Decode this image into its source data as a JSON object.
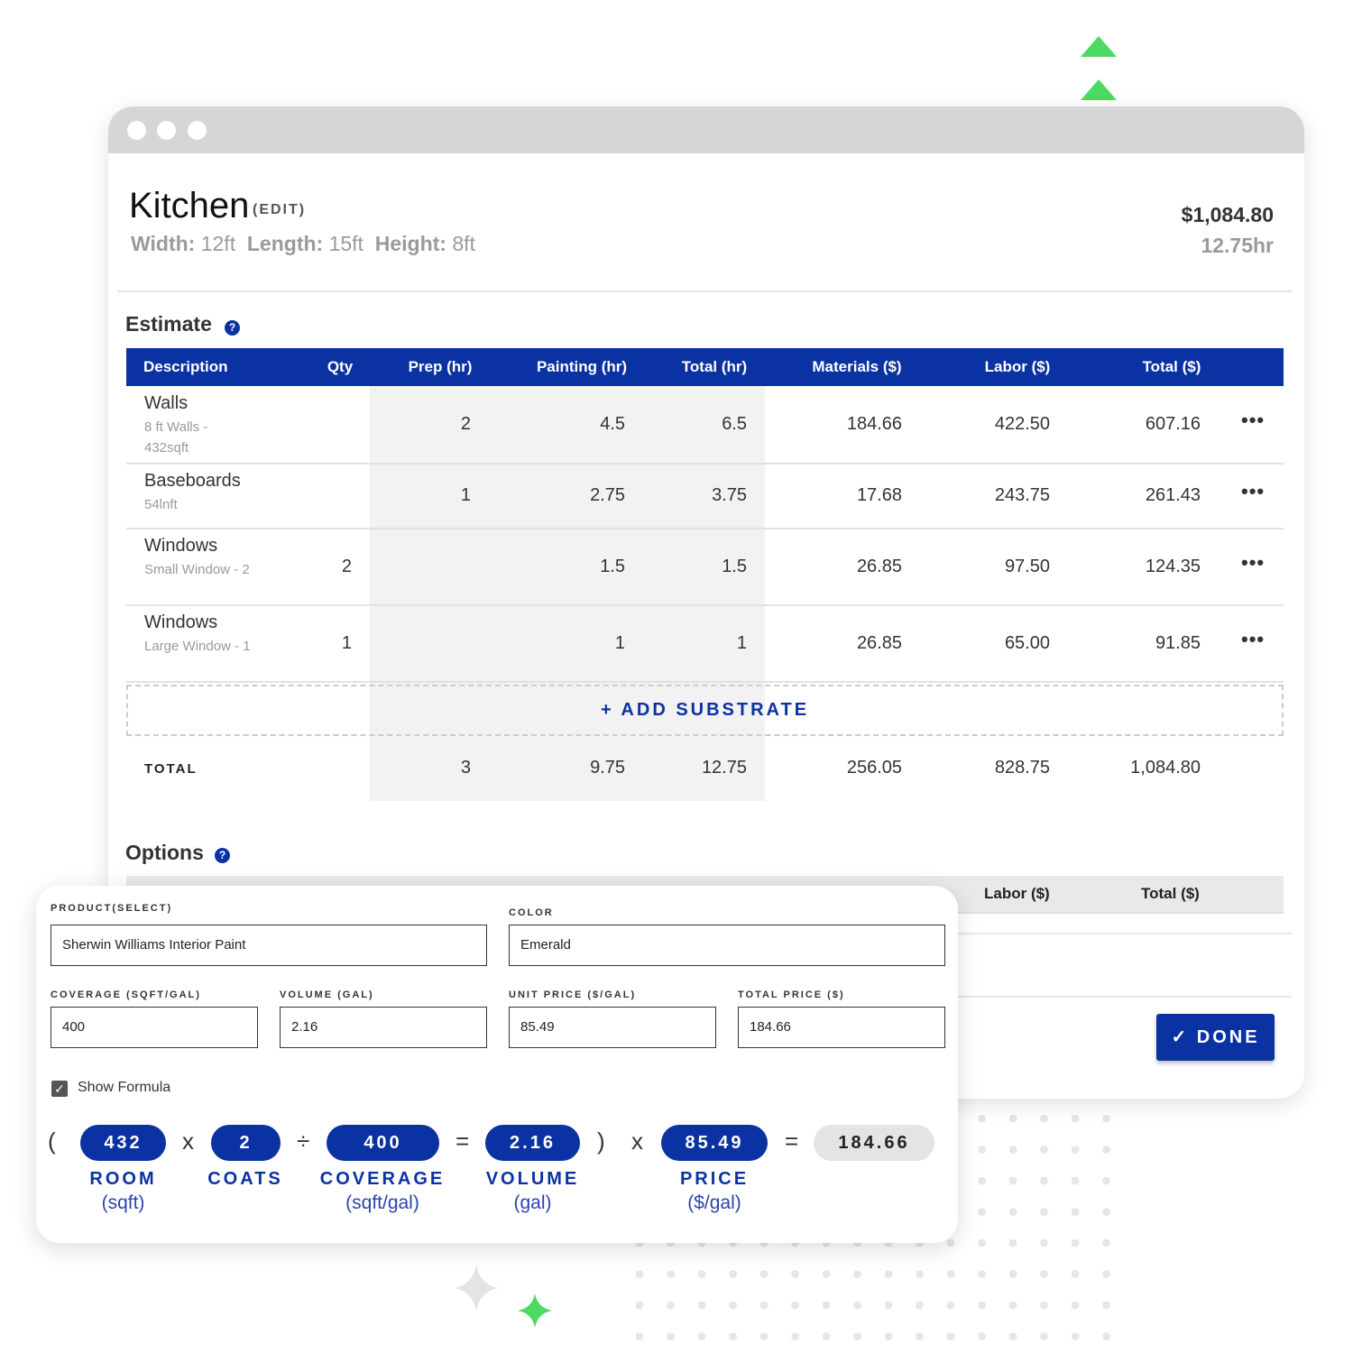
{
  "room": {
    "name": "Kitchen",
    "edit_label": "(EDIT)",
    "dimensions": [
      {
        "label": "Width:",
        "value": "12ft"
      },
      {
        "label": "Length:",
        "value": "15ft"
      },
      {
        "label": "Height:",
        "value": "8ft"
      }
    ],
    "total_price": "$1,084.80",
    "total_hours": "12.75hr"
  },
  "estimate": {
    "title": "Estimate",
    "columns": [
      "Description",
      "Qty",
      "Prep (hr)",
      "Painting (hr)",
      "Total (hr)",
      "Materials ($)",
      "Labor ($)",
      "Total ($)"
    ],
    "rows": [
      {
        "name": "Walls",
        "sub": "8 ft Walls - 432sqft",
        "qty": "",
        "prep": "2",
        "painting": "4.5",
        "total_hr": "6.5",
        "materials": "184.66",
        "labor": "422.50",
        "total": "607.16"
      },
      {
        "name": "Baseboards",
        "sub": "54lnft",
        "qty": "",
        "prep": "1",
        "painting": "2.75",
        "total_hr": "3.75",
        "materials": "17.68",
        "labor": "243.75",
        "total": "261.43"
      },
      {
        "name": "Windows",
        "sub": "Small Window - 2",
        "qty": "2",
        "prep": "",
        "painting": "1.5",
        "total_hr": "1.5",
        "materials": "26.85",
        "labor": "97.50",
        "total": "124.35"
      },
      {
        "name": "Windows",
        "sub": "Large Window - 1",
        "qty": "1",
        "prep": "",
        "painting": "1",
        "total_hr": "1",
        "materials": "26.85",
        "labor": "65.00",
        "total": "91.85"
      }
    ],
    "add_substrate": "+  ADD SUBSTRATE",
    "totals": {
      "label": "TOTAL",
      "prep": "3",
      "painting": "9.75",
      "total_hr": "12.75",
      "materials": "256.05",
      "labor": "828.75",
      "total": "1,084.80"
    }
  },
  "options": {
    "title": "Options",
    "columns": [
      "Labor ($)",
      "Total ($)"
    ]
  },
  "done_label": "DONE",
  "material": {
    "product_label": "PRODUCT(SELECT)",
    "product": "Sherwin Williams Interior Paint",
    "color_label": "COLOR",
    "color": "Emerald",
    "coverage_label": "COVERAGE (SQFT/GAL)",
    "coverage": "400",
    "volume_label": "VOLUME (GAL)",
    "volume": "2.16",
    "unit_price_label": "UNIT PRICE ($/GAL)",
    "unit_price": "85.49",
    "total_price_label": "TOTAL PRICE ($)",
    "total_price": "184.66",
    "show_formula_label": "Show Formula",
    "show_formula": true
  },
  "formula": {
    "open": "(",
    "close": ")",
    "times": "x",
    "divide": "÷",
    "equals": "=",
    "room": {
      "value": "432",
      "label": "ROOM",
      "unit": "(sqft)"
    },
    "coats": {
      "value": "2",
      "label": "COATS"
    },
    "coverage": {
      "value": "400",
      "label": "COVERAGE",
      "unit": "(sqft/gal)"
    },
    "volume": {
      "value": "2.16",
      "label": "VOLUME",
      "unit": "(gal)"
    },
    "price": {
      "value": "85.49",
      "label": "PRICE",
      "unit": "($/gal)"
    },
    "result": "184.66"
  },
  "colors": {
    "brand_blue": "#0b32a2",
    "accent_green": "#4cd964"
  }
}
